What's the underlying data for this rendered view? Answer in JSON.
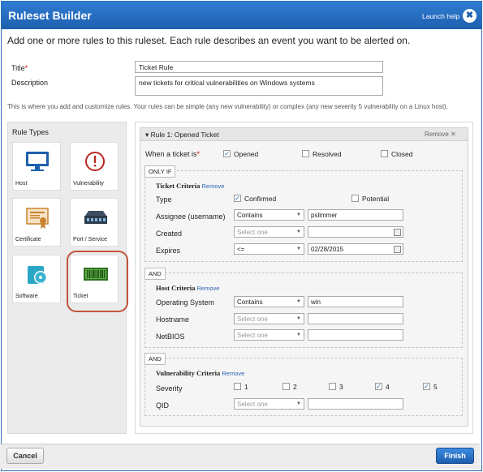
{
  "window": {
    "title": "Ruleset Builder",
    "launch_help": "Launch help",
    "close_glyph": "✖"
  },
  "intro": "Add one or more rules to this ruleset. Each rule describes an event you want to be alerted on.",
  "form": {
    "title_label": "Title",
    "title_required": "*",
    "title_value": "Ticket Rule",
    "description_label": "Description",
    "description_value": "new tickets for critical vulnerabilities on Windows systems"
  },
  "hint": "This is where you add and customize rules. Your rules can be simple (any new vulnerability) or complex (any new severity 5 vulnerability on a Linux host).",
  "rule_types": {
    "heading": "Rule Types",
    "items": [
      {
        "label": "Host",
        "icon": "monitor-icon"
      },
      {
        "label": "Vulnerability",
        "icon": "exclamation-icon"
      },
      {
        "label": "Certificate",
        "icon": "certificate-icon"
      },
      {
        "label": "Port / Service",
        "icon": "network-switch-icon"
      },
      {
        "label": "Software",
        "icon": "software-disc-icon"
      },
      {
        "label": "Ticket",
        "icon": "ticket-icon",
        "highlighted": true
      }
    ]
  },
  "rule": {
    "header": "Rule 1: Opened Ticket",
    "remove": "Remove ✕",
    "when_label": "When a ticket is",
    "when_required": "*",
    "when_options": [
      {
        "label": "Opened",
        "checked": true
      },
      {
        "label": "Resolved",
        "checked": false
      },
      {
        "label": "Closed",
        "checked": false
      }
    ],
    "only_if": "ONLY IF",
    "and_label": "AND",
    "ticket": {
      "title": "Ticket Criteria",
      "remove": "Remove",
      "type_label": "Type",
      "type_options": [
        {
          "label": "Confirmed",
          "checked": true
        },
        {
          "label": "Potential",
          "checked": false
        }
      ],
      "assignee_label": "Assignee (username)",
      "assignee_op": "Contains",
      "assignee_value": "pslimmer",
      "created_label": "Created",
      "created_op": "Select one",
      "expires_label": "Expires",
      "expires_op": "<=",
      "expires_value": "02/28/2015"
    },
    "host": {
      "title": "Host Criteria",
      "remove": "Remove",
      "os_label": "Operating System",
      "os_op": "Contains",
      "os_value": "win",
      "hostname_label": "Hostname",
      "hostname_op": "Select one",
      "netbios_label": "NetBIOS",
      "netbios_op": "Select one"
    },
    "vuln": {
      "title": "Vulnerability Criteria",
      "remove": "Remove",
      "severity_label": "Severity",
      "severity_options": [
        {
          "label": "1",
          "checked": false
        },
        {
          "label": "2",
          "checked": false
        },
        {
          "label": "3",
          "checked": false
        },
        {
          "label": "4",
          "checked": true
        },
        {
          "label": "5",
          "checked": true
        }
      ],
      "qid_label": "QID",
      "qid_op": "Select one"
    }
  },
  "footer": {
    "cancel": "Cancel",
    "finish": "Finish"
  },
  "colors": {
    "titlebar": "#1e5fae",
    "accent_ring": "#c0563c",
    "link": "#2a62b3"
  }
}
